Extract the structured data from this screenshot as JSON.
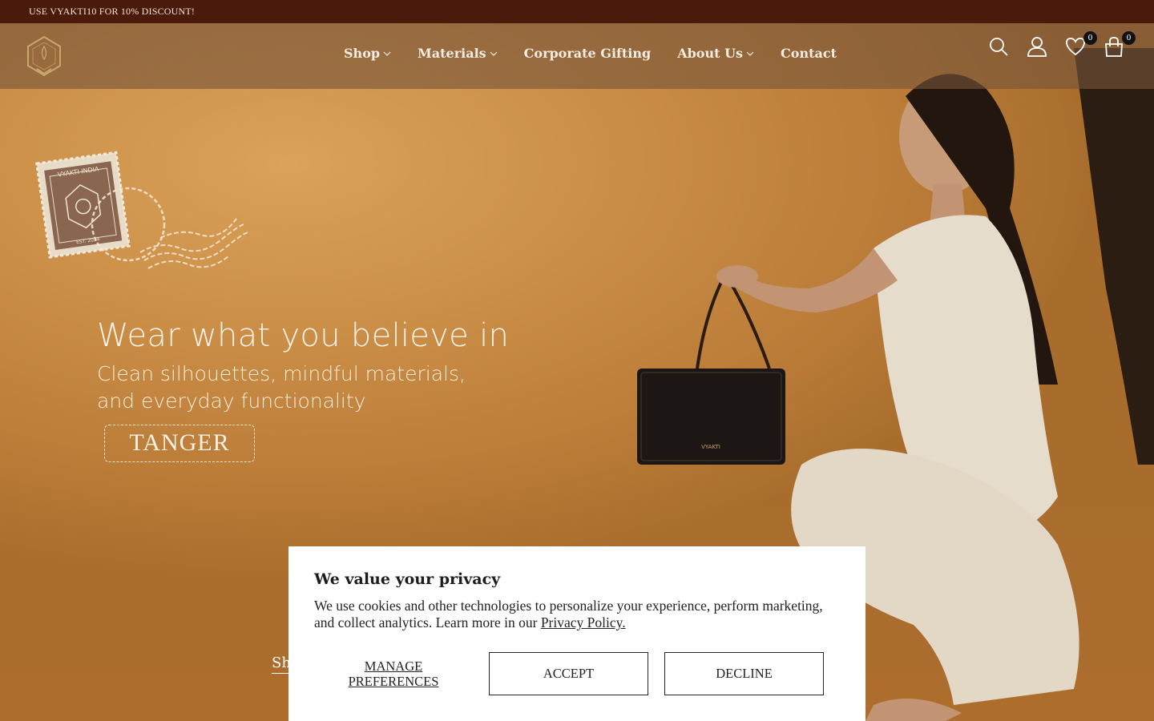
{
  "announcement": "USE VYAKTI10 FOR 10% DISCOUNT!",
  "brand": {
    "logo_icon": "vyakti-hexagon-logo"
  },
  "nav": {
    "items": [
      {
        "label": "Shop",
        "has_dropdown": true
      },
      {
        "label": "Materials",
        "has_dropdown": true
      },
      {
        "label": "Corporate Gifting",
        "has_dropdown": false
      },
      {
        "label": "About Us",
        "has_dropdown": true
      },
      {
        "label": "Contact",
        "has_dropdown": false
      }
    ]
  },
  "header_icons": {
    "search": "search-icon",
    "account": "user-icon",
    "wishlist": {
      "icon": "heart-icon",
      "count": "0"
    },
    "cart": {
      "icon": "shopping-bag-icon",
      "count": "0"
    }
  },
  "hero": {
    "headline": "Wear what you believe in",
    "subline_1": "Clean silhouettes, mindful materials,",
    "subline_2": "and everyday functionality",
    "product_tag": "TANGER",
    "stamp_text_top": "VYAKTI INDIA",
    "stamp_text_bottom": "EST. 2024",
    "bag_logo": "VYAKTI",
    "shop_link": "Sh"
  },
  "cookie": {
    "title": "We value your privacy",
    "body": "We use cookies and other technologies to personalize your experience, perform marketing, and collect analytics. Learn more in our ",
    "policy_link": "Privacy Policy.",
    "manage_label_1": "MANAGE",
    "manage_label_2": "PREFERENCES",
    "accept_label": "ACCEPT",
    "decline_label": "DECLINE"
  },
  "colors": {
    "announcement_bg": "#4a1a0c",
    "hero_bg": "#c98c45",
    "header_overlay": "#78563a"
  }
}
